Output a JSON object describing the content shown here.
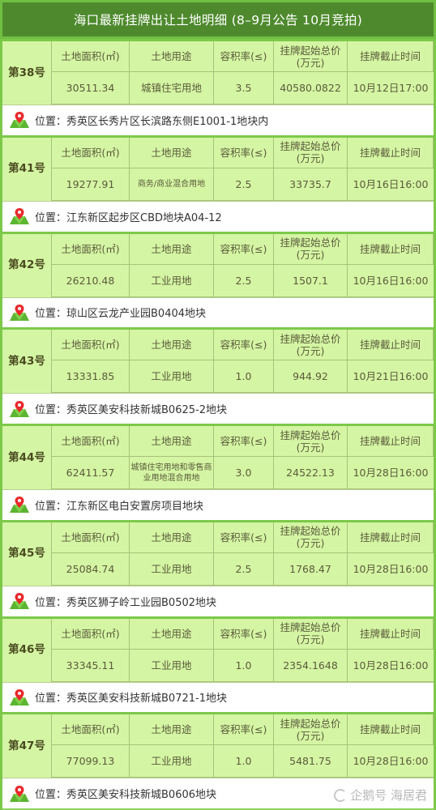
{
  "title": "海口最新挂牌出让土地明细 (8–9月公告 10月竞拍)",
  "headers": {
    "area": "土地面积(㎡)",
    "use": "土地用途",
    "far": "容积率(≤)",
    "price": "挂牌起始总价\n(万元)",
    "price_line1": "挂牌起始总价",
    "price_line2": "(万元)",
    "deadline": "挂牌截止时间"
  },
  "location_label": "位置：",
  "watermark": "企鹅号 海居君",
  "colors": {
    "title_bg": "#4e8a2d",
    "table_bg": "#d4f5a3",
    "border_green": "#7cc94a",
    "pin_red": "#e8292b",
    "map_green": "#5cb531"
  },
  "lots": [
    {
      "lot": "第38号",
      "area": "30511.34",
      "use": "城镇住宅用地",
      "use_small": false,
      "far": "3.5",
      "price": "40580.0822",
      "deadline": "10月12日17:00",
      "location": "秀英区长秀片区长滨路东侧E1001-1地块内"
    },
    {
      "lot": "第41号",
      "area": "19277.91",
      "use": "商务/商业混合用地",
      "use_small": true,
      "far": "2.5",
      "price": "33735.7",
      "deadline": "10月16日16:00",
      "location": "江东新区起步区CBD地块A04-12"
    },
    {
      "lot": "第42号",
      "area": "26210.48",
      "use": "工业用地",
      "use_small": false,
      "far": "2.5",
      "price": "1507.1",
      "deadline": "10月16日16:00",
      "location": "琼山区云龙产业园B0404地块"
    },
    {
      "lot": "第43号",
      "area": "13331.85",
      "use": "工业用地",
      "use_small": false,
      "far": "1.0",
      "price": "944.92",
      "deadline": "10月21日16:00",
      "location": "秀英区美安科技新城B0625-2地块"
    },
    {
      "lot": "第44号",
      "area": "62411.57",
      "use": "城镇住宅用地和零售商业用地混合用地",
      "use_small": true,
      "far": "3.0",
      "price": "24522.13",
      "deadline": "10月28日16:00",
      "location": "江东新区电白安置房项目地块"
    },
    {
      "lot": "第45号",
      "area": "25084.74",
      "use": "工业用地",
      "use_small": false,
      "far": "2.5",
      "price": "1768.47",
      "deadline": "10月28日16:00",
      "location": "秀英区狮子岭工业园B0502地块"
    },
    {
      "lot": "第46号",
      "area": "33345.11",
      "use": "工业用地",
      "use_small": false,
      "far": "1.0",
      "price": "2354.1648",
      "deadline": "10月28日16:00",
      "location": "秀英区美安科技新城B0721-1地块"
    },
    {
      "lot": "第47号",
      "area": "77099.13",
      "use": "工业用地",
      "use_small": false,
      "far": "1.0",
      "price": "5481.75",
      "deadline": "10月28日16:00",
      "location": "秀英区美安科技新城B0606地块"
    }
  ]
}
